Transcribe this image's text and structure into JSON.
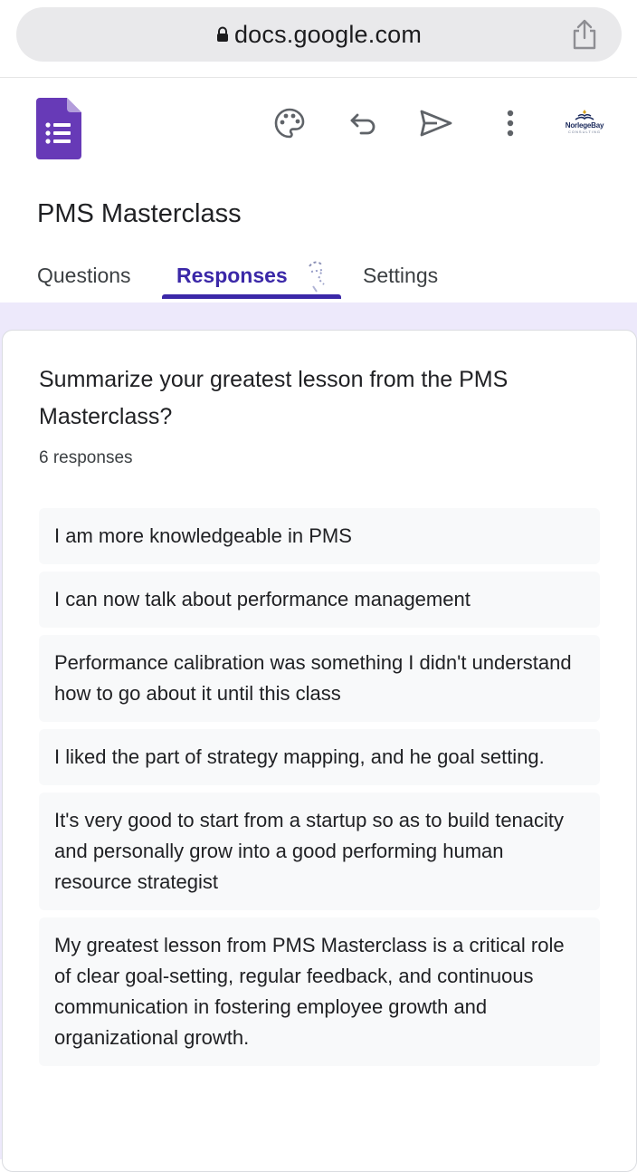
{
  "browser": {
    "url": "docs.google.com"
  },
  "header": {
    "form_title": "PMS Masterclass",
    "brand_name": "NorlegeBay",
    "brand_sub": "CONSULTING",
    "tabs": [
      {
        "label": "Questions"
      },
      {
        "label": "Responses"
      },
      {
        "label": "Settings"
      }
    ]
  },
  "colors": {
    "forms_purple": "#673ab7",
    "accent": "#3b28a8",
    "content_bg": "#ede9fb"
  },
  "question": {
    "title": "Summarize your greatest lesson from the PMS Masterclass?",
    "response_count": "6 responses",
    "responses": [
      {
        "text": "I am more knowledgeable in PMS"
      },
      {
        "text": "I can now talk about performance management"
      },
      {
        "text": "Performance calibration was something I didn't understand how to go about it until this class"
      },
      {
        "text": "I liked the part of strategy mapping, and he goal setting."
      },
      {
        "text": "It's very good to start from a startup so as to build tenacity and personally grow into a good performing human resource strategist"
      },
      {
        "text": "My greatest lesson from PMS Masterclass is a critical role of clear goal-setting, regular feedback, and continuous communication in fostering employee growth and organizational growth."
      }
    ]
  }
}
